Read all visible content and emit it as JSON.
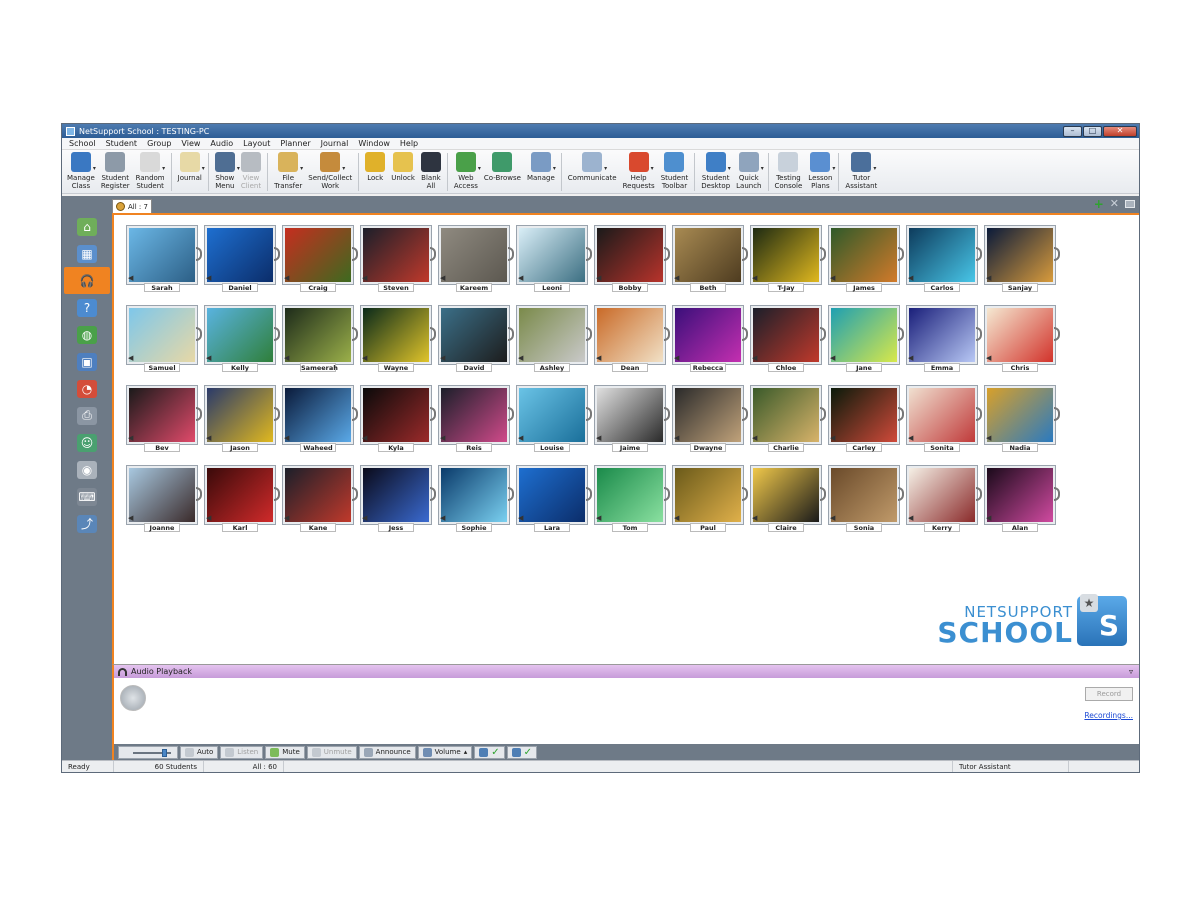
{
  "window": {
    "title": "NetSupport School : TESTING-PC"
  },
  "menu": [
    "School",
    "Student",
    "Group",
    "View",
    "Audio",
    "Layout",
    "Planner",
    "Journal",
    "Window",
    "Help"
  ],
  "toolbar": [
    {
      "l1": "Manage",
      "l2": "Class",
      "color": "#3a78c2",
      "caret": true,
      "disabled": false,
      "icon": "manage-class-icon"
    },
    {
      "l1": "Student",
      "l2": "Register",
      "color": "#8d9aa8",
      "caret": false,
      "disabled": false,
      "icon": "student-register-icon"
    },
    {
      "l1": "Random",
      "l2": "Student",
      "color": "#d9d9d9",
      "caret": true,
      "disabled": false,
      "icon": "dice-icon"
    },
    {
      "sep": true
    },
    {
      "l1": "Journal",
      "l2": "",
      "color": "#e7d9a6",
      "caret": true,
      "disabled": false,
      "icon": "journal-icon"
    },
    {
      "sep": true
    },
    {
      "l1": "Show",
      "l2": "Menu",
      "color": "#4f6e93",
      "caret": true,
      "disabled": false,
      "icon": "show-menu-icon"
    },
    {
      "l1": "View",
      "l2": "Client",
      "color": "#b7bcc2",
      "caret": false,
      "disabled": true,
      "icon": "view-client-icon"
    },
    {
      "sep": true
    },
    {
      "l1": "File",
      "l2": "Transfer",
      "color": "#d9b35b",
      "caret": true,
      "disabled": false,
      "icon": "file-transfer-icon"
    },
    {
      "l1": "Send/Collect",
      "l2": "Work",
      "color": "#c58b3c",
      "caret": true,
      "disabled": false,
      "icon": "send-collect-icon"
    },
    {
      "sep": true
    },
    {
      "l1": "Lock",
      "l2": "",
      "color": "#e0b12a",
      "caret": false,
      "disabled": false,
      "icon": "lock-icon"
    },
    {
      "l1": "Unlock",
      "l2": "",
      "color": "#e6c24e",
      "caret": false,
      "disabled": false,
      "icon": "unlock-icon"
    },
    {
      "l1": "Blank",
      "l2": "All",
      "color": "#2e3440",
      "caret": false,
      "disabled": false,
      "icon": "monitor-icon"
    },
    {
      "sep": true
    },
    {
      "l1": "Web",
      "l2": "Access",
      "color": "#4aa049",
      "caret": true,
      "disabled": false,
      "icon": "globe-icon"
    },
    {
      "l1": "Co-Browse",
      "l2": "",
      "color": "#3f9a6a",
      "caret": false,
      "disabled": false,
      "icon": "co-browse-icon"
    },
    {
      "l1": "Manage",
      "l2": "",
      "color": "#7a9bc4",
      "caret": true,
      "disabled": false,
      "icon": "manage-apps-icon"
    },
    {
      "sep": true
    },
    {
      "l1": "Communicate",
      "l2": "",
      "color": "#9cb3cf",
      "caret": true,
      "disabled": false,
      "icon": "communicate-icon"
    },
    {
      "l1": "Help",
      "l2": "Requests",
      "color": "#d9492e",
      "caret": true,
      "disabled": false,
      "icon": "lifebuoy-icon"
    },
    {
      "l1": "Student",
      "l2": "Toolbar",
      "color": "#4e8fcf",
      "caret": false,
      "disabled": false,
      "icon": "student-toolbar-icon"
    },
    {
      "sep": true
    },
    {
      "l1": "Student",
      "l2": "Desktop",
      "color": "#3f7fc6",
      "caret": true,
      "disabled": false,
      "icon": "student-desktop-icon"
    },
    {
      "l1": "Quick",
      "l2": "Launch",
      "color": "#8fa4bd",
      "caret": true,
      "disabled": false,
      "icon": "rocket-icon"
    },
    {
      "sep": true
    },
    {
      "l1": "Testing",
      "l2": "Console",
      "color": "#c8d1db",
      "caret": false,
      "disabled": false,
      "icon": "testing-console-icon"
    },
    {
      "l1": "Lesson",
      "l2": "Plans",
      "color": "#5a8fd1",
      "caret": true,
      "disabled": false,
      "icon": "puzzle-icon"
    },
    {
      "sep": true
    },
    {
      "l1": "Tutor",
      "l2": "Assistant",
      "color": "#4b6f9b",
      "caret": true,
      "disabled": false,
      "icon": "tutor-assistant-icon"
    }
  ],
  "tab": {
    "label": "All : 7"
  },
  "sidebar": [
    {
      "name": "sidebar-home",
      "icon": "house-icon",
      "glyph": "⌂",
      "color": "#6fae5a",
      "active": false
    },
    {
      "name": "sidebar-layout",
      "icon": "layout-icon",
      "glyph": "▦",
      "color": "#5b8fcc",
      "active": false
    },
    {
      "name": "sidebar-audio",
      "icon": "headphones-icon",
      "glyph": "🎧",
      "color": "#f08321",
      "active": true
    },
    {
      "name": "sidebar-help",
      "icon": "question-icon",
      "glyph": "?",
      "color": "#4c8bd0",
      "active": false
    },
    {
      "name": "sidebar-web",
      "icon": "globe-icon",
      "glyph": "◍",
      "color": "#4aa049",
      "active": false
    },
    {
      "name": "sidebar-apps",
      "icon": "window-icon",
      "glyph": "▣",
      "color": "#4e7fbf",
      "active": false
    },
    {
      "name": "sidebar-stats",
      "icon": "pie-chart-icon",
      "glyph": "◔",
      "color": "#d44d3a",
      "active": false
    },
    {
      "name": "sidebar-print",
      "icon": "printer-icon",
      "glyph": "⎙",
      "color": "#8b96a3",
      "active": false
    },
    {
      "name": "sidebar-students",
      "icon": "user-icon",
      "glyph": "☺",
      "color": "#4aa070",
      "active": false
    },
    {
      "name": "sidebar-devices",
      "icon": "disc-icon",
      "glyph": "◉",
      "color": "#aab2bb",
      "active": false
    },
    {
      "name": "sidebar-keyboard",
      "icon": "keyboard-icon",
      "glyph": "⌨",
      "color": "#7d8793",
      "active": false
    },
    {
      "name": "sidebar-monitor",
      "icon": "line-chart-icon",
      "glyph": "⤴",
      "color": "#5a86b8",
      "active": false
    }
  ],
  "students": [
    {
      "name": "Sarah",
      "a": "#6bb7e6",
      "b": "#2c5f86"
    },
    {
      "name": "Daniel",
      "a": "#1e6fd0",
      "b": "#0b2d6a"
    },
    {
      "name": "Craig",
      "a": "#c62d1f",
      "b": "#3d6a1f"
    },
    {
      "name": "Steven",
      "a": "#1b1f2a",
      "b": "#c0392b"
    },
    {
      "name": "Kareem",
      "a": "#8f8a80",
      "b": "#5c5850"
    },
    {
      "name": "Leoni",
      "a": "#d9eef7",
      "b": "#3c6f82"
    },
    {
      "name": "Bobby",
      "a": "#1a1a1a",
      "b": "#b8332b"
    },
    {
      "name": "Beth",
      "a": "#a88a52",
      "b": "#4e3c20"
    },
    {
      "name": "T-Jay",
      "a": "#1d2a12",
      "b": "#e0b81f"
    },
    {
      "name": "James",
      "a": "#2f5a2a",
      "b": "#d27a2a"
    },
    {
      "name": "Carlos",
      "a": "#0d3b5c",
      "b": "#48c6e8"
    },
    {
      "name": "Sanjay",
      "a": "#0a1a3a",
      "b": "#d89b3c"
    },
    {
      "name": "Samuel",
      "a": "#7ec7ea",
      "b": "#e7d8a6"
    },
    {
      "name": "Kelly",
      "a": "#59b3e0",
      "b": "#2f7f3a"
    },
    {
      "name": "Sameerah",
      "a": "#1d2b1a",
      "b": "#9bb04a"
    },
    {
      "name": "Wayne",
      "a": "#0a2a1a",
      "b": "#e0c42a"
    },
    {
      "name": "David",
      "a": "#3b6f88",
      "b": "#1d1d1d"
    },
    {
      "name": "Ashley",
      "a": "#7a8a4a",
      "b": "#c9c9c9"
    },
    {
      "name": "Dean",
      "a": "#c96a28",
      "b": "#f1e1c6"
    },
    {
      "name": "Rebecca",
      "a": "#3a0f7a",
      "b": "#c42fb0"
    },
    {
      "name": "Chloe",
      "a": "#1b1f2a",
      "b": "#c0392b"
    },
    {
      "name": "Jane",
      "a": "#1e9fb2",
      "b": "#d8e84a"
    },
    {
      "name": "Emma",
      "a": "#1a1f7a",
      "b": "#b8c8f5"
    },
    {
      "name": "Chris",
      "a": "#f5e9d2",
      "b": "#d2332b"
    },
    {
      "name": "Bev",
      "a": "#1a1a1a",
      "b": "#e04a6a"
    },
    {
      "name": "Jason",
      "a": "#2a3a6a",
      "b": "#e0b81f"
    },
    {
      "name": "Waheed",
      "a": "#0a1a3a",
      "b": "#5aa9e8"
    },
    {
      "name": "Kyla",
      "a": "#0a0a0a",
      "b": "#9b2a2a"
    },
    {
      "name": "Reis",
      "a": "#1b1f2a",
      "b": "#d04a8a"
    },
    {
      "name": "Louise",
      "a": "#6ac3e6",
      "b": "#1a6f9a"
    },
    {
      "name": "Jaime",
      "a": "#e0e0e0",
      "b": "#2a2a2a"
    },
    {
      "name": "Dwayne",
      "a": "#2a2a2a",
      "b": "#c0a27a"
    },
    {
      "name": "Charlie",
      "a": "#3a5a2a",
      "b": "#d8b36a"
    },
    {
      "name": "Carley",
      "a": "#0a1a0a",
      "b": "#d04a3a"
    },
    {
      "name": "Sonita",
      "a": "#f0e0d0",
      "b": "#c03a3a"
    },
    {
      "name": "Nadia",
      "a": "#d8a02a",
      "b": "#2a7ac0"
    },
    {
      "name": "Joanne",
      "a": "#a8c8e0",
      "b": "#3a2a2a"
    },
    {
      "name": "Karl",
      "a": "#3a0a0a",
      "b": "#d02a2a"
    },
    {
      "name": "Kane",
      "a": "#1b1f2a",
      "b": "#c0392b"
    },
    {
      "name": "Jess",
      "a": "#0a0a1a",
      "b": "#3a6ad0"
    },
    {
      "name": "Sophie",
      "a": "#0a3a6a",
      "b": "#7ad0f0"
    },
    {
      "name": "Lara",
      "a": "#1e6fd0",
      "b": "#0b2d6a"
    },
    {
      "name": "Tom",
      "a": "#1a8a4a",
      "b": "#8ae0a0"
    },
    {
      "name": "Paul",
      "a": "#6a5a1a",
      "b": "#e0b04a"
    },
    {
      "name": "Claire",
      "a": "#f0c84a",
      "b": "#1a1a1a"
    },
    {
      "name": "Sonia",
      "a": "#6a4a2a",
      "b": "#c09a6a"
    },
    {
      "name": "Kerry",
      "a": "#f5f0e6",
      "b": "#8a2a2a"
    },
    {
      "name": "Alan",
      "a": "#1a0a1a",
      "b": "#d04aa0"
    }
  ],
  "logo": {
    "line1": "NETSUPPORT",
    "line2": "SCHOOL"
  },
  "audio": {
    "header": "Audio Playback",
    "record": "Record",
    "recordings": "Recordings..."
  },
  "audio_toolbar": {
    "volume_level": 0.8,
    "auto": "Auto",
    "listen": "Listen",
    "mute": "Mute",
    "unmute": "Unmute",
    "announce": "Announce",
    "volume": "Volume"
  },
  "status": {
    "ready": "Ready",
    "students": "60 Students",
    "all": "All : 60",
    "tutor": "Tutor Assistant"
  }
}
